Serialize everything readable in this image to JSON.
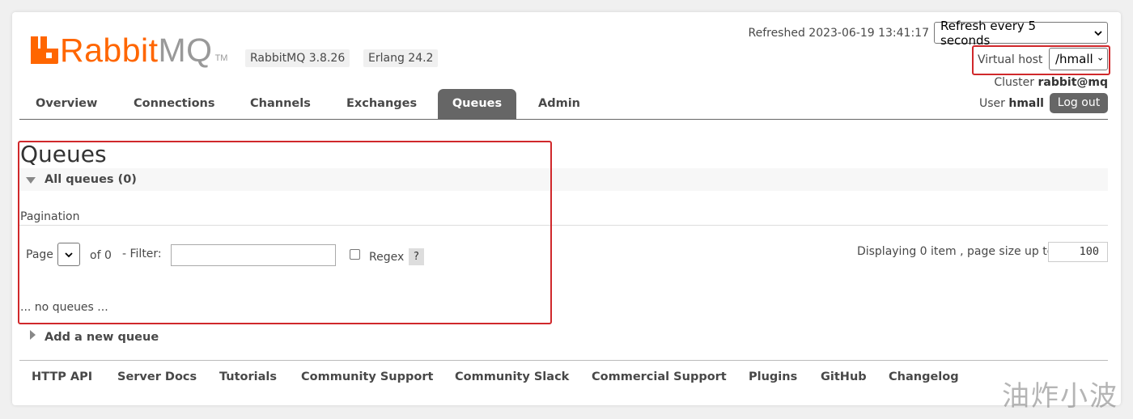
{
  "colors": {
    "brand": "#ff6600",
    "tab_active_bg": "#666666",
    "highlight": "#d0282b"
  },
  "logo": {
    "rabbit": "Rabbit",
    "mq": "MQ",
    "tm": "TM"
  },
  "badges": {
    "rabbitmq_version": "RabbitMQ 3.8.26",
    "erlang_version": "Erlang 24.2"
  },
  "header": {
    "refreshed": "Refreshed 2023-06-19 13:41:17",
    "refresh_select": "Refresh every 5 seconds",
    "vhost_label": "Virtual host",
    "vhost_select": "/hmall",
    "cluster_label": "Cluster",
    "cluster_name": "rabbit@mq",
    "user_label": "User",
    "user_name": "hmall",
    "logout": "Log out"
  },
  "nav": {
    "tabs": [
      {
        "label": "Overview"
      },
      {
        "label": "Connections"
      },
      {
        "label": "Channels"
      },
      {
        "label": "Exchanges"
      },
      {
        "label": "Queues",
        "active": true
      },
      {
        "label": "Admin"
      }
    ]
  },
  "main": {
    "title": "Queues",
    "all_queues": "All queues (0)",
    "pagination_label": "Pagination",
    "page_label": "Page",
    "of_label": "of 0",
    "filter_label": "- Filter:",
    "filter_value": "",
    "regex_label": "Regex",
    "help": "?",
    "displaying": "Displaying 0 item , page size up to:",
    "page_size": "100",
    "empty_text": "... no queues ...",
    "add_queue": "Add a new queue"
  },
  "footer": {
    "links": [
      "HTTP API",
      "Server Docs",
      "Tutorials",
      "Community Support",
      "Community Slack",
      "Commercial Support",
      "Plugins",
      "GitHub",
      "Changelog"
    ]
  },
  "watermark": "油炸小波",
  "icons": {
    "select_arrow": "chevron-down-icon",
    "collapse": "triangle-down-icon",
    "expand": "triangle-right-icon"
  }
}
